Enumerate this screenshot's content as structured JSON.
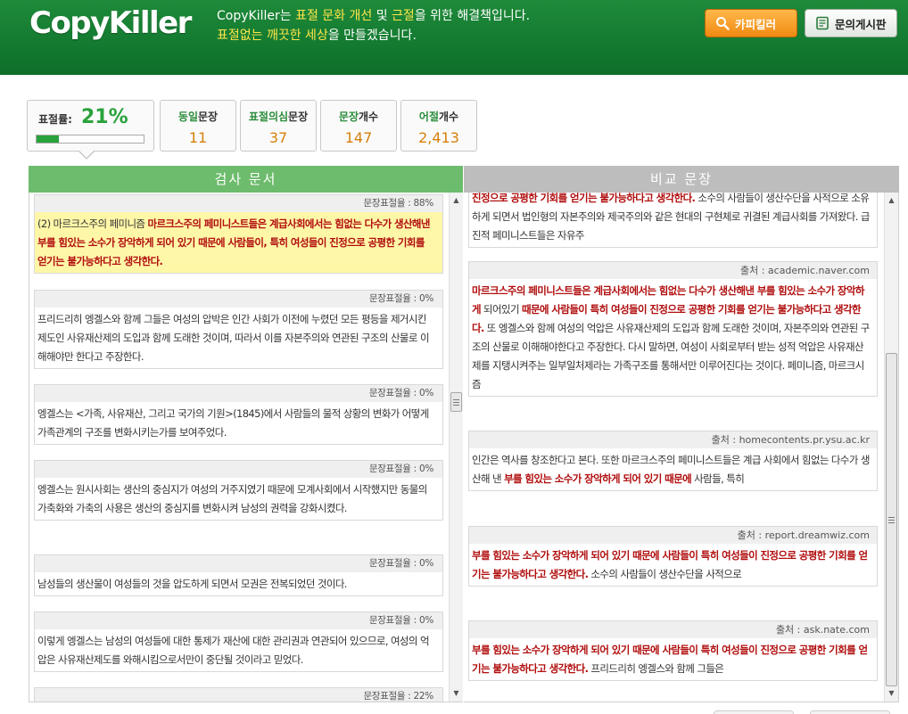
{
  "header": {
    "logo": "CopyKiller",
    "slogan": {
      "line1_brand": "CopyKiller",
      "line1_text1": "는 ",
      "line1_hl1": "표절 문화 개선",
      "line1_text2": " 및 ",
      "line1_hl2": "근절",
      "line1_text3": "을 위한 해결책입니다.",
      "line2_hl1": "표절없는 깨끗한 세상",
      "line2_text": "을 만들겠습니다."
    },
    "buttons": {
      "copykiller": "카피킬러",
      "board": "문의게시판"
    },
    "colors": {
      "header_green": "#137a30",
      "highlight_yellow": "#ffe54a",
      "button_orange": "#f08a12"
    }
  },
  "stats": {
    "plagiarism_label": "표절률:",
    "plagiarism_rate": "21%",
    "plagiarism_fraction": 0.21,
    "boxes": [
      {
        "label_green": "동일",
        "label_rest": "문장",
        "value": "11"
      },
      {
        "label_green": "표절의심",
        "label_rest": "문장",
        "value": "37"
      },
      {
        "label_green": "문장",
        "label_rest": "개수",
        "value": "147"
      },
      {
        "label_green": "어절",
        "label_rest": "개수",
        "value": "2,413"
      }
    ]
  },
  "panels": {
    "left_title": "검사 문서",
    "right_title": "비교 문장"
  },
  "left_blocks": [
    {
      "rate": "문장표절율 : 88%",
      "highlight": true,
      "parts": [
        {
          "t": "(2) 마르크스주의 페미니즘 ",
          "red": false
        },
        {
          "t": "마르크스주의 페미니스트들은 계급사회에서는 힘없는 다수가 생산해낸 부를 힘있는 소수가 장악하게 되어 있기 때문에 사람들이, 특히 여성들이 진정으로 공평한 기회를 얻기는 불가능하다고 생각한다.",
          "red": true
        }
      ]
    },
    {
      "rate": "문장표절율 : 0%",
      "highlight": false,
      "parts": [
        {
          "t": "프리드리히 엥겔스와 함께 그들은 여성의 압박은 인간 사회가 이전에 누렸던 모든 평등을 제거시킨 제도인 사유재산제의 도입과 함께 도래한 것이며, 따라서 이를 자본주의와 연관된 구조의 산물로 이해해야만 한다고 주장한다.",
          "red": false
        }
      ]
    },
    {
      "rate": "문장표절율 : 0%",
      "highlight": false,
      "parts": [
        {
          "t": "엥겔스는 <가족, 사유재산, 그리고 국가의 기원>(1845)에서 사람들의 물적 상황의 변화가 어떻게 가족관계의 구조를 변화시키는가를 보여주었다.",
          "red": false
        }
      ]
    },
    {
      "rate": "문장표절율 : 0%",
      "highlight": false,
      "parts": [
        {
          "t": "엥겔스는 원시사회는 생산의 중심지가 여성의 거주지였기 때문에 모계사회에서 시작했지만 동물의 가축화와 가축의 사용은 생산의 중심지를 변화시켜 남성의 권력을 강화시켰다.",
          "red": false
        }
      ]
    },
    {
      "rate": "문장표절율 : 0%",
      "highlight": false,
      "parts": [
        {
          "t": "남성들의 생산물이 여성들의 것을 압도하게 되면서 모권은 전복되었던 것이다.",
          "red": false
        }
      ]
    },
    {
      "rate": "문장표절율 : 0%",
      "highlight": false,
      "parts": [
        {
          "t": "이렇게 엥겔스는 남성의 여성들에 대한 통제가 재산에 대한 관리권과 연관되어 있으므로, 여성의 억압은 사유재산제도를 와해시킴으로서만이 중단될 것이라고 믿었다.",
          "red": false
        }
      ]
    },
    {
      "rate": "문장표절율 : 22%",
      "highlight": false,
      "parts": []
    }
  ],
  "right_blocks": [
    {
      "source": "",
      "parts": [
        {
          "t": "진정으로 공평한 기회를 얻기는 불가능하다고 생각한다.",
          "red": true
        },
        {
          "t": " 소수의 사람들이 생산수단을 사적으로 소유하게 되면서 법인형의 자본주의와 제국주의와 같은 현대의 구현체로 귀결된 계급사회를 가져왔다. 급진적 페미니스트들은 자유주",
          "red": false
        }
      ]
    },
    {
      "source": "출처 : academic.naver.com",
      "parts": [
        {
          "t": "마르크스주의 페미니스트들은 계급사회에서는 힘없는 다수가 생산해낸 부를 힘있는 소수가 장악하게",
          "red": true
        },
        {
          "t": " 되어있기 ",
          "red": false
        },
        {
          "t": "때문에 사람들이 특히 여성들이 진정으로 공평한 기회를 얻기는 불가능하다고 생각한다.",
          "red": true
        },
        {
          "t": " 또 엥겔스와 함께 여성의 억압은 사유재산제의 도입과 함께 도래한 것이며, 자본주의와 연관된 구조의 산물로 이해해야한다고 주장한다. 다시 말하면, 여성이 사회로부터 받는 성적 억압은 사유재산제를 지탱시켜주는 일부일처제라는 가족구조를 통해서만 이루어진다는 것이다. 페미니즘, 마르크시즘",
          "red": false
        }
      ]
    },
    {
      "source": "출처 : homecontents.pr.ysu.ac.kr",
      "parts": [
        {
          "t": "인간은 역사를 창조한다고 본다. 또한 마르크스주의 페미니스트들은 계급 사회에서 힘없는 다수가 생산해 낸 ",
          "red": false
        },
        {
          "t": "부를 힘있는 소수가 장악하게 되어 있기 때문에",
          "red": true
        },
        {
          "t": " 사람들, 특히",
          "red": false
        }
      ]
    },
    {
      "source": "출처 : report.dreamwiz.com",
      "parts": [
        {
          "t": "부를 힘있는 소수가 장악하게 되어 있기 때문에 사람들이 특히 여성들이 진정으로 공평한 기회를 얻기는 불가능하다고 생각한다.",
          "red": true
        },
        {
          "t": " 소수의 사람들이 생산수단을 사적으로",
          "red": false
        }
      ]
    },
    {
      "source": "출처 : ask.nate.com",
      "parts": [
        {
          "t": "부를 힘있는 소수가 장악하게 되어 있기 때문에 사람들이 특히 여성들이 진정으로 공평한 기회를 얻기는 불가능하다고 생각한다.",
          "red": true
        },
        {
          "t": " 프리드리히 엥겔스와 함께 그들은",
          "red": false
        }
      ]
    }
  ]
}
